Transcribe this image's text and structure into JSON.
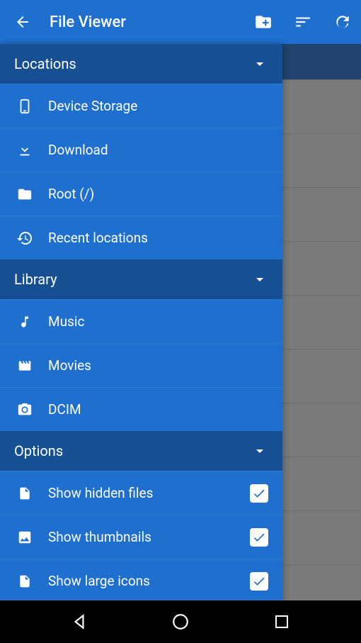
{
  "toolbar": {
    "title": "File Viewer"
  },
  "drawer": {
    "sections": [
      {
        "title": "Locations",
        "items": [
          {
            "icon": "phone",
            "label": "Device Storage"
          },
          {
            "icon": "download",
            "label": "Download"
          },
          {
            "icon": "folder",
            "label": "Root (/)"
          },
          {
            "icon": "history",
            "label": "Recent locations"
          }
        ]
      },
      {
        "title": "Library",
        "items": [
          {
            "icon": "music",
            "label": "Music"
          },
          {
            "icon": "movie",
            "label": "Movies"
          },
          {
            "icon": "camera",
            "label": "DCIM"
          }
        ]
      },
      {
        "title": "Options",
        "items": [
          {
            "icon": "file",
            "label": "Show hidden files",
            "checked": true
          },
          {
            "icon": "image",
            "label": "Show thumbnails",
            "checked": true
          },
          {
            "icon": "file",
            "label": "Show large icons",
            "checked": true
          }
        ]
      }
    ]
  },
  "colors": {
    "primary": "#1e6fce",
    "primaryDark": "#174f93",
    "bgHeader": "#22436d",
    "bgRow": "#7a7a7a"
  }
}
